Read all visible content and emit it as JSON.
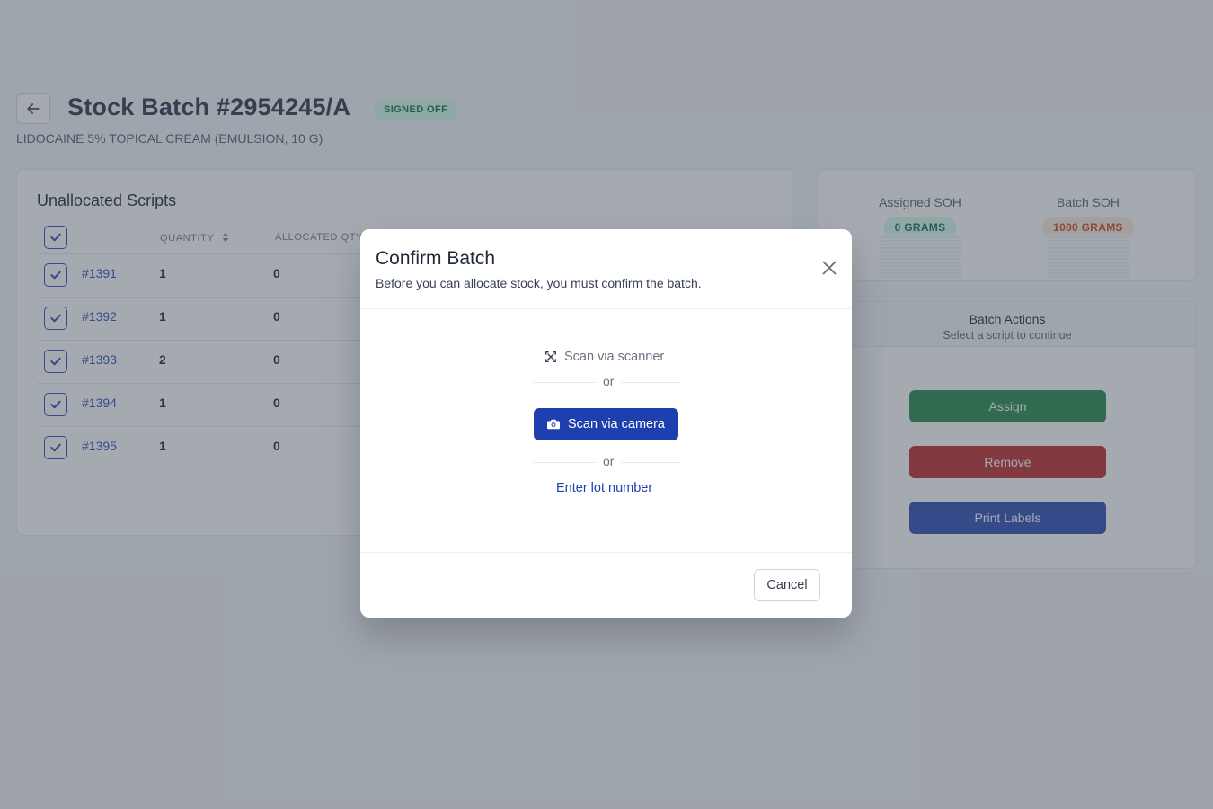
{
  "header": {
    "title": "Stock Batch #2954245/A",
    "status_badge": "SIGNED OFF",
    "subtitle": "LIDOCAINE 5% TOPICAL CREAM (EMULSION, 10 G)"
  },
  "scripts": {
    "title": "Unallocated Scripts",
    "columns": {
      "quantity": "QUANTITY",
      "allocated": "ALLOCATED QTY"
    },
    "rows": [
      {
        "id": "#1391",
        "quantity": "1",
        "allocated": "0"
      },
      {
        "id": "#1392",
        "quantity": "1",
        "allocated": "0"
      },
      {
        "id": "#1393",
        "quantity": "2",
        "allocated": "0"
      },
      {
        "id": "#1394",
        "quantity": "1",
        "allocated": "0"
      },
      {
        "id": "#1395",
        "quantity": "1",
        "allocated": "0"
      }
    ]
  },
  "soh": {
    "assigned_label": "Assigned SOH",
    "assigned_value": "0 GRAMS",
    "batch_label": "Batch SOH",
    "batch_value": "1000 GRAMS"
  },
  "actions": {
    "title": "Batch Actions",
    "subtitle": "Select a script to continue",
    "assign": "Assign",
    "remove": "Remove",
    "print": "Print Labels"
  },
  "modal": {
    "title": "Confirm Batch",
    "description": "Before you can allocate stock, you must confirm the batch.",
    "scan_scanner": "Scan via scanner",
    "or": "or",
    "scan_camera": "Scan via camera",
    "enter_lot": "Enter lot number",
    "cancel": "Cancel"
  },
  "colors": {
    "primary": "#1e40af",
    "assign": "#15803d",
    "remove": "#b91c1c",
    "signed_bg": "#d1fae5",
    "assigned_bg": "#d1fae5",
    "batch_bg": "#fde7d9"
  },
  "icons": [
    "arrow-left-icon",
    "checkbox-check-icon",
    "sort-icon",
    "close-icon",
    "scan-icon",
    "camera-icon"
  ]
}
